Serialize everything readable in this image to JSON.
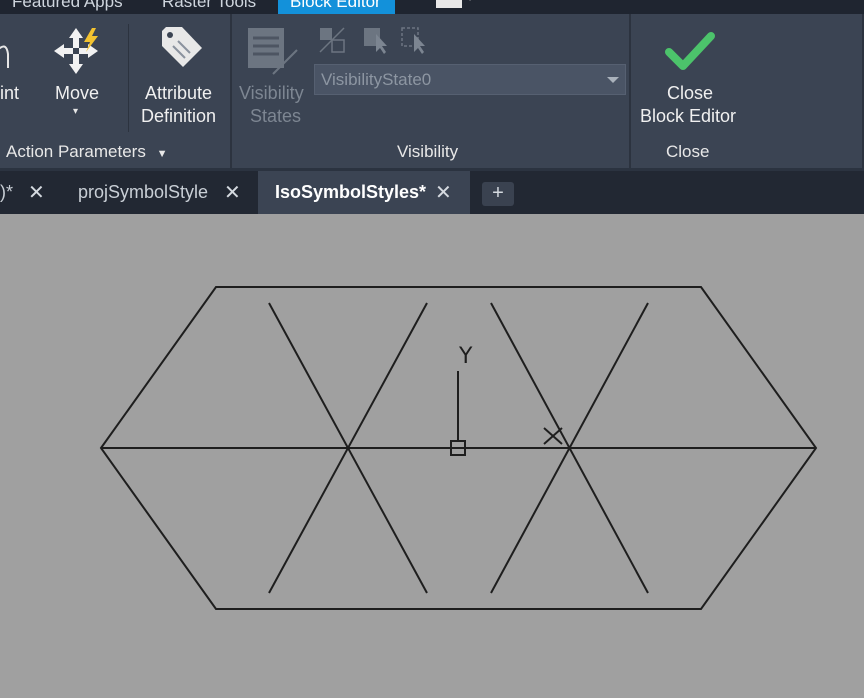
{
  "ribbon_tabs": [
    {
      "label": "Featured Apps"
    },
    {
      "label": "Raster Tools"
    },
    {
      "label": "Block Editor",
      "active": true
    }
  ],
  "ribbon": {
    "point_label": "int",
    "move_label": "Move",
    "attribute_label_line1": "Attribute",
    "attribute_label_line2": "Definition",
    "visibility_states_line1": "Visibility",
    "visibility_states_line2": "States",
    "visibility_dropdown_value": "VisibilityState0",
    "close_line1": "Close",
    "close_line2": "Block Editor",
    "panels": {
      "action_parameters": "Action Parameters",
      "visibility": "Visibility",
      "close": "Close"
    }
  },
  "doc_tabs": [
    {
      "label": ")*"
    },
    {
      "label": "projSymbolStyle"
    },
    {
      "label": "IsoSymbolStyles*",
      "active": true
    }
  ],
  "canvas": {
    "ucs_y_label": "Y",
    "ucs_x_label": "X"
  },
  "colors": {
    "ribbon_bg": "#3b4453",
    "active_tab": "#1391da",
    "canvas_bg": "#a0a0a0",
    "check_green": "#4cc36b"
  }
}
